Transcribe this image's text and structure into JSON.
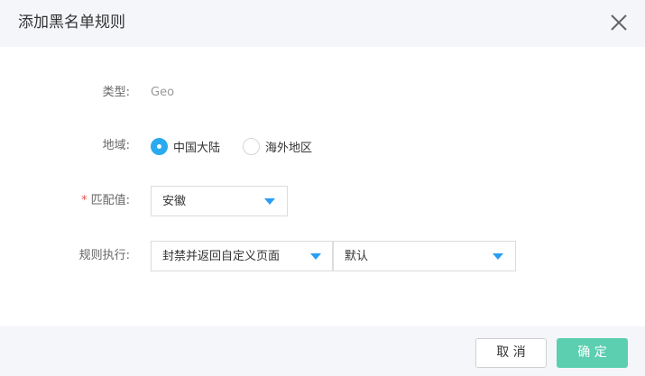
{
  "dialog": {
    "title": "添加黑名单规则",
    "close_icon": "close-icon"
  },
  "form": {
    "type": {
      "label": "类型:",
      "value": "Geo"
    },
    "region": {
      "label": "地域:",
      "options": [
        {
          "label": "中国大陆",
          "selected": true
        },
        {
          "label": "海外地区",
          "selected": false
        }
      ]
    },
    "match": {
      "required_mark": "*",
      "label": "匹配值:",
      "value": "安徽"
    },
    "action": {
      "label": "规则执行:",
      "value": "封禁并返回自定义页面",
      "page_value": "默认"
    }
  },
  "footer": {
    "cancel_label": "取 消",
    "ok_label": "确 定"
  },
  "colors": {
    "accent": "#2aaaf0",
    "caret": "#2a9df4",
    "ok_button": "#5ccfb0",
    "required": "#e9544e",
    "header_bg": "#f4f6fa"
  }
}
